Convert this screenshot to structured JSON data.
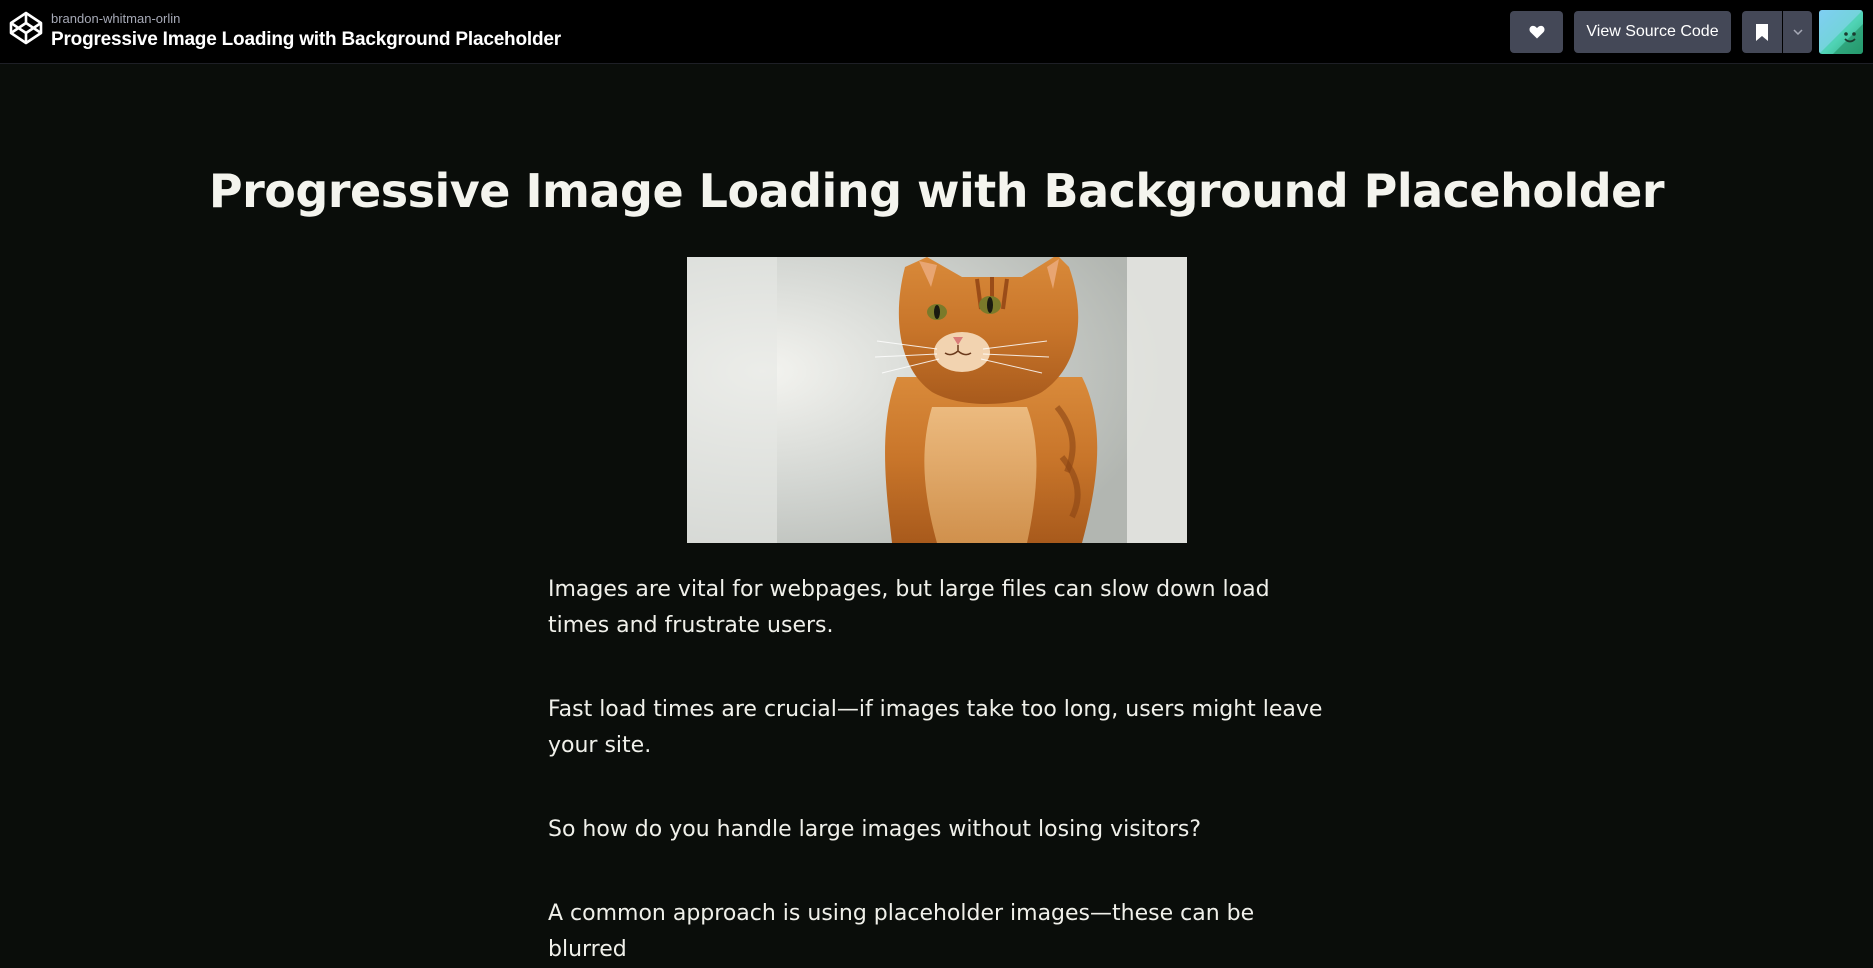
{
  "header": {
    "author": "brandon-whitman-orlin",
    "pen_title": "Progressive Image Loading with Background Placeholder",
    "view_source_label": "View Source Code"
  },
  "icons": {
    "logo": "codepen-logo-icon",
    "heart": "heart-icon",
    "bookmark": "bookmark-icon",
    "caret": "chevron-down-icon",
    "avatar": "user-avatar"
  },
  "colors": {
    "topbar_bg": "#000000",
    "page_bg": "#0a0d0a",
    "button_bg": "#444857",
    "text": "#f0f0ea"
  },
  "content": {
    "title": "Progressive Image Loading with Background Placeholder",
    "paragraphs": [
      "Images are vital for webpages, but large files can slow down load times and frustrate users.",
      "Fast load times are crucial—if images take too long, users might leave your site.",
      "So how do you handle large images without losing visitors?",
      "A common approach is using placeholder images—these can be blurred"
    ]
  }
}
